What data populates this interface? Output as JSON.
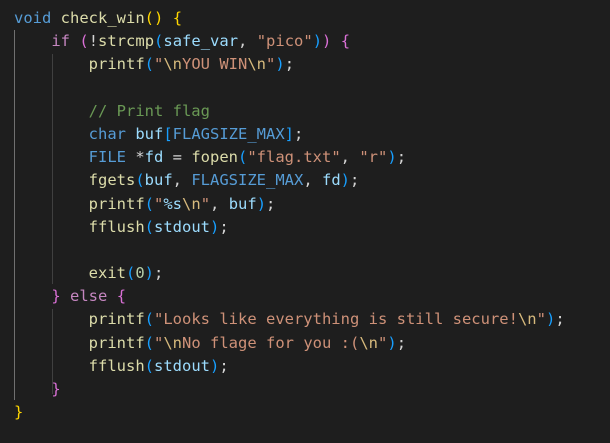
{
  "colors": {
    "background": "#1e1e1e",
    "keyword": "#569cd6",
    "control": "#c586c0",
    "function": "#dcdcaa",
    "string": "#ce9178",
    "escape": "#d7ba7d",
    "variable": "#9cdcfe",
    "macro": "#569cd6",
    "type": "#4ec9b0",
    "number": "#b5cea8",
    "comment": "#6a9955",
    "plain": "#d4d4d4",
    "bracket1": "#ffd700",
    "bracket2": "#da70d6",
    "bracket3": "#179fff"
  },
  "code": {
    "lines": [
      {
        "indent": "",
        "tokens": [
          {
            "t": "void",
            "c": "keyword"
          },
          {
            "t": " ",
            "c": "plain"
          },
          {
            "t": "check_win",
            "c": "function"
          },
          {
            "t": "()",
            "c": "bracket1"
          },
          {
            "t": " ",
            "c": "plain"
          },
          {
            "t": "{",
            "c": "bracket1"
          }
        ]
      },
      {
        "indent": "    ",
        "tokens": [
          {
            "t": "if",
            "c": "control"
          },
          {
            "t": " ",
            "c": "plain"
          },
          {
            "t": "(",
            "c": "bracket2"
          },
          {
            "t": "!",
            "c": "plain"
          },
          {
            "t": "strcmp",
            "c": "function"
          },
          {
            "t": "(",
            "c": "bracket3"
          },
          {
            "t": "safe_var",
            "c": "variable"
          },
          {
            "t": ", ",
            "c": "plain"
          },
          {
            "t": "\"pico\"",
            "c": "string"
          },
          {
            "t": ")",
            "c": "bracket3"
          },
          {
            "t": ")",
            "c": "bracket2"
          },
          {
            "t": " ",
            "c": "plain"
          },
          {
            "t": "{",
            "c": "bracket2"
          }
        ]
      },
      {
        "indent": "        ",
        "tokens": [
          {
            "t": "printf",
            "c": "function"
          },
          {
            "t": "(",
            "c": "bracket3"
          },
          {
            "t": "\"",
            "c": "string"
          },
          {
            "t": "\\n",
            "c": "escape"
          },
          {
            "t": "YOU WIN",
            "c": "string"
          },
          {
            "t": "\\n",
            "c": "escape"
          },
          {
            "t": "\"",
            "c": "string"
          },
          {
            "t": ")",
            "c": "bracket3"
          },
          {
            "t": ";",
            "c": "plain"
          }
        ]
      },
      {
        "indent": "",
        "tokens": []
      },
      {
        "indent": "        ",
        "tokens": [
          {
            "t": "// Print flag",
            "c": "comment"
          }
        ]
      },
      {
        "indent": "        ",
        "tokens": [
          {
            "t": "char",
            "c": "keyword"
          },
          {
            "t": " ",
            "c": "plain"
          },
          {
            "t": "buf",
            "c": "variable"
          },
          {
            "t": "[",
            "c": "bracket3"
          },
          {
            "t": "FLAGSIZE_MAX",
            "c": "macro"
          },
          {
            "t": "]",
            "c": "bracket3"
          },
          {
            "t": ";",
            "c": "plain"
          }
        ]
      },
      {
        "indent": "        ",
        "tokens": [
          {
            "t": "FILE",
            "c": "macro"
          },
          {
            "t": " *",
            "c": "plain"
          },
          {
            "t": "fd",
            "c": "variable"
          },
          {
            "t": " = ",
            "c": "plain"
          },
          {
            "t": "fopen",
            "c": "function"
          },
          {
            "t": "(",
            "c": "bracket3"
          },
          {
            "t": "\"flag.txt\"",
            "c": "string"
          },
          {
            "t": ", ",
            "c": "plain"
          },
          {
            "t": "\"r\"",
            "c": "string"
          },
          {
            "t": ")",
            "c": "bracket3"
          },
          {
            "t": ";",
            "c": "plain"
          }
        ]
      },
      {
        "indent": "        ",
        "tokens": [
          {
            "t": "fgets",
            "c": "function"
          },
          {
            "t": "(",
            "c": "bracket3"
          },
          {
            "t": "buf",
            "c": "variable"
          },
          {
            "t": ", ",
            "c": "plain"
          },
          {
            "t": "FLAGSIZE_MAX",
            "c": "macro"
          },
          {
            "t": ", ",
            "c": "plain"
          },
          {
            "t": "fd",
            "c": "variable"
          },
          {
            "t": ")",
            "c": "bracket3"
          },
          {
            "t": ";",
            "c": "plain"
          }
        ]
      },
      {
        "indent": "        ",
        "tokens": [
          {
            "t": "printf",
            "c": "function"
          },
          {
            "t": "(",
            "c": "bracket3"
          },
          {
            "t": "\"",
            "c": "string"
          },
          {
            "t": "%s",
            "c": "variable"
          },
          {
            "t": "\\n",
            "c": "escape"
          },
          {
            "t": "\"",
            "c": "string"
          },
          {
            "t": ", ",
            "c": "plain"
          },
          {
            "t": "buf",
            "c": "variable"
          },
          {
            "t": ")",
            "c": "bracket3"
          },
          {
            "t": ";",
            "c": "plain"
          }
        ]
      },
      {
        "indent": "        ",
        "tokens": [
          {
            "t": "fflush",
            "c": "function"
          },
          {
            "t": "(",
            "c": "bracket3"
          },
          {
            "t": "stdout",
            "c": "variable"
          },
          {
            "t": ")",
            "c": "bracket3"
          },
          {
            "t": ";",
            "c": "plain"
          }
        ]
      },
      {
        "indent": "",
        "tokens": []
      },
      {
        "indent": "        ",
        "tokens": [
          {
            "t": "exit",
            "c": "function"
          },
          {
            "t": "(",
            "c": "bracket3"
          },
          {
            "t": "0",
            "c": "number"
          },
          {
            "t": ")",
            "c": "bracket3"
          },
          {
            "t": ";",
            "c": "plain"
          }
        ]
      },
      {
        "indent": "    ",
        "tokens": [
          {
            "t": "}",
            "c": "bracket2"
          },
          {
            "t": " ",
            "c": "plain"
          },
          {
            "t": "else",
            "c": "control"
          },
          {
            "t": " ",
            "c": "plain"
          },
          {
            "t": "{",
            "c": "bracket2"
          }
        ]
      },
      {
        "indent": "        ",
        "tokens": [
          {
            "t": "printf",
            "c": "function"
          },
          {
            "t": "(",
            "c": "bracket3"
          },
          {
            "t": "\"Looks like everything is still secure!",
            "c": "string"
          },
          {
            "t": "\\n",
            "c": "escape"
          },
          {
            "t": "\"",
            "c": "string"
          },
          {
            "t": ")",
            "c": "bracket3"
          },
          {
            "t": ";",
            "c": "plain"
          }
        ]
      },
      {
        "indent": "        ",
        "tokens": [
          {
            "t": "printf",
            "c": "function"
          },
          {
            "t": "(",
            "c": "bracket3"
          },
          {
            "t": "\"",
            "c": "string"
          },
          {
            "t": "\\n",
            "c": "escape"
          },
          {
            "t": "No flage for you :(",
            "c": "string"
          },
          {
            "t": "\\n",
            "c": "escape"
          },
          {
            "t": "\"",
            "c": "string"
          },
          {
            "t": ")",
            "c": "bracket3"
          },
          {
            "t": ";",
            "c": "plain"
          }
        ]
      },
      {
        "indent": "        ",
        "tokens": [
          {
            "t": "fflush",
            "c": "function"
          },
          {
            "t": "(",
            "c": "bracket3"
          },
          {
            "t": "stdout",
            "c": "variable"
          },
          {
            "t": ")",
            "c": "bracket3"
          },
          {
            "t": ";",
            "c": "plain"
          }
        ]
      },
      {
        "indent": "    ",
        "tokens": [
          {
            "t": "}",
            "c": "bracket2"
          }
        ]
      },
      {
        "indent": "",
        "tokens": [
          {
            "t": "}",
            "c": "bracket1"
          }
        ]
      }
    ]
  }
}
